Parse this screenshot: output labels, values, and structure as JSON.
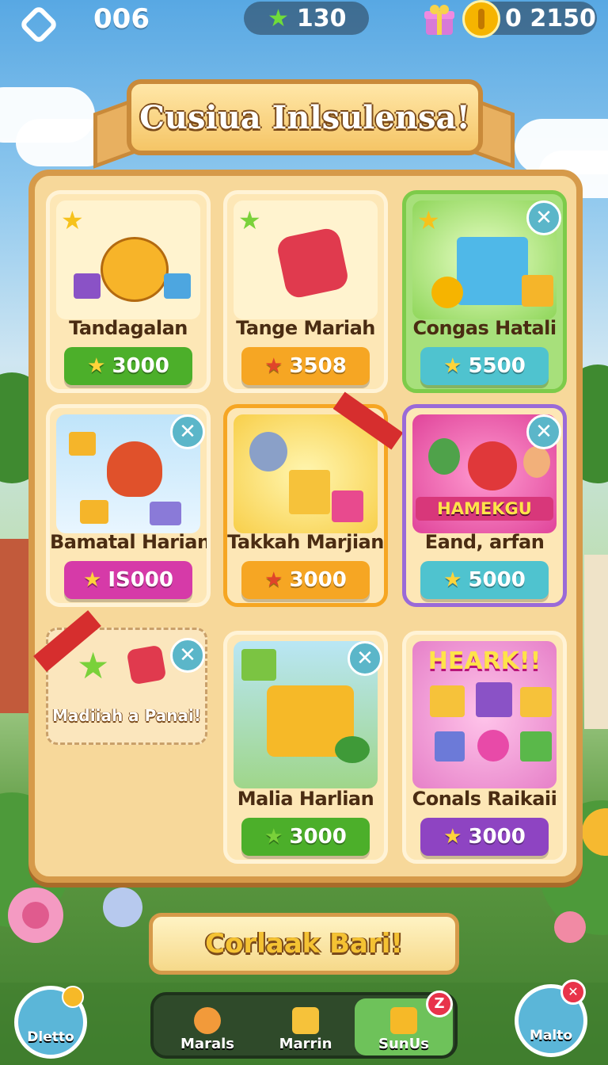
{
  "hud": {
    "level": "006",
    "stars": "130",
    "coins": "0 2150"
  },
  "banner": {
    "title": "Cusiua Inlsulensa!"
  },
  "cards": [
    {
      "title": "Tandagalan",
      "price": "3000",
      "price_color": "#4caf2a",
      "star_color": "#ffd43a"
    },
    {
      "title": "Tange Mariah",
      "price": "3508",
      "price_color": "#f6a623",
      "star_color": "#e0442a"
    },
    {
      "title": "Congas Hatali",
      "price": "5500",
      "price_color": "#4fc3cf",
      "star_color": "#ffd43a"
    },
    {
      "title": "Bamatal Harian",
      "price": "IS000",
      "price_color": "#d63aa8",
      "star_color": "#ffd43a"
    },
    {
      "title": "Takkah Marjian",
      "price": "3000",
      "price_color": "#f6a623",
      "star_color": "#e0442a"
    },
    {
      "title": "Eand, arfan",
      "price": "5000",
      "price_color": "#4fc3cf",
      "star_color": "#ffd43a"
    },
    {
      "title": "Malia Harlian",
      "price": "3000",
      "price_color": "#4caf2a",
      "star_color": "#7ad13a"
    },
    {
      "title": "Conals Raikaii",
      "price": "3000",
      "price_color": "#8e44c2",
      "star_color": "#ffd43a"
    }
  ],
  "art_labels": {
    "hamekgu": "HAMEKGU",
    "heark": "HEARK!!"
  },
  "note": {
    "text": "Madiiah a Panai!"
  },
  "cta": {
    "label": "Corlaak Bari!"
  },
  "close_glyph": "✕",
  "star_glyph": "★",
  "nav": {
    "left_button": "Dletto",
    "right_button": "Malto",
    "items": [
      {
        "label": "Marals"
      },
      {
        "label": "Marrin"
      },
      {
        "label": "SunUs",
        "badge": "Z"
      }
    ]
  }
}
